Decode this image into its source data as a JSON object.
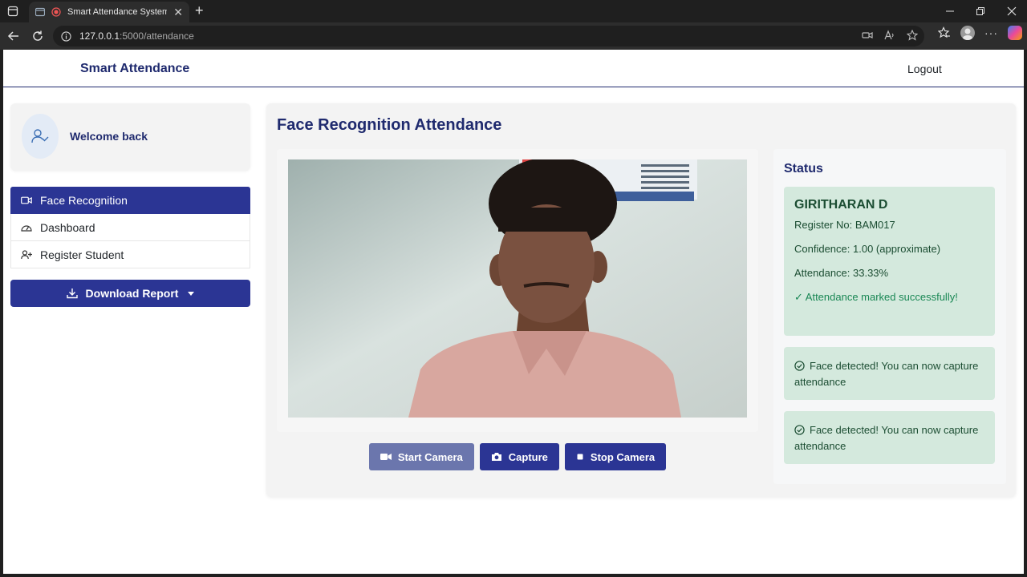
{
  "browser": {
    "tab_title": "Smart Attendance System - I",
    "url_host": "127.0.0.1",
    "url_path": ":5000/attendance"
  },
  "navbar": {
    "brand": "Smart Attendance",
    "logout": "Logout"
  },
  "sidebar": {
    "welcome": "Welcome back",
    "items": [
      {
        "label": "Face Recognition",
        "icon": "video-icon",
        "active": true
      },
      {
        "label": "Dashboard",
        "icon": "speedometer-icon",
        "active": false
      },
      {
        "label": "Register Student",
        "icon": "person-add-icon",
        "active": false
      }
    ],
    "download_label": "Download Report"
  },
  "main": {
    "title": "Face Recognition Attendance",
    "buttons": {
      "start": "Start Camera",
      "capture": "Capture",
      "stop": "Stop Camera"
    }
  },
  "status": {
    "title": "Status",
    "result": {
      "name": "GIRITHARAN D",
      "register": "Register No: BAM017",
      "confidence": "Confidence: 1.00 (approximate)",
      "attendance": "Attendance: 33.33%",
      "success": "✓ Attendance marked successfully!"
    },
    "alerts": [
      "Face detected! You can now capture attendance",
      "Face detected! You can now capture attendance"
    ]
  },
  "colors": {
    "primary": "#2b3594",
    "brand_text": "#1f2a6e",
    "success_bg": "#d4e9dd",
    "success_text": "#198754"
  }
}
